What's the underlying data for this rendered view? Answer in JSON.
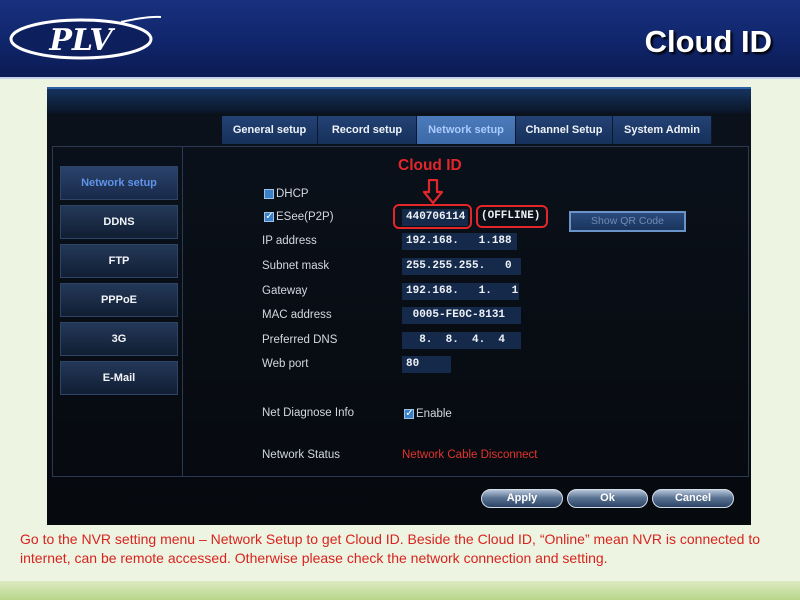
{
  "colors": {
    "banner": "#10256b",
    "slide_bg": "#edf4e1",
    "annotation_red": "#e3262a",
    "caption_red": "#d8231f",
    "status_red": "#e2352d",
    "tab_active": "#3c69a8"
  },
  "slide": {
    "logo_text": "PLV",
    "title": "Cloud ID",
    "caption": "Go to the NVR setting menu – Network Setup to get Cloud ID. Beside the Cloud ID, “Online” mean NVR is connected to internet, can be remote accessed. Otherwise please check the network connection and setting."
  },
  "annotation": {
    "label": "Cloud ID",
    "icon": "down-arrow-icon"
  },
  "nvr": {
    "tabs": [
      {
        "label": "General setup",
        "active": false
      },
      {
        "label": "Record setup",
        "active": false
      },
      {
        "label": "Network setup",
        "active": true
      },
      {
        "label": "Channel Setup",
        "active": false
      },
      {
        "label": "System Admin",
        "active": false
      }
    ],
    "sidebar": [
      {
        "label": "Network setup",
        "active": true
      },
      {
        "label": "DDNS",
        "active": false
      },
      {
        "label": "FTP",
        "active": false
      },
      {
        "label": "PPPoE",
        "active": false
      },
      {
        "label": "3G",
        "active": false
      },
      {
        "label": "E-Mail",
        "active": false
      }
    ],
    "form": {
      "dhcp": {
        "label": "DHCP",
        "checked": false
      },
      "esee": {
        "label": "ESee(P2P)",
        "checked": true,
        "cloud_id": "440706114",
        "status": "(OFFLINE)",
        "qr_button": "Show QR Code"
      },
      "ip_address": {
        "label": "IP address",
        "value": "192.168.   1.188"
      },
      "subnet_mask": {
        "label": "Subnet mask",
        "value": "255.255.255.   0"
      },
      "gateway": {
        "label": "Gateway",
        "value": "192.168.   1.   1"
      },
      "mac_address": {
        "label": "MAC address",
        "value": " 0005-FE0C-8131"
      },
      "preferred_dns": {
        "label": "Preferred DNS",
        "value": "  8.  8.  4.  4"
      },
      "web_port": {
        "label": "Web port",
        "value": "80"
      },
      "net_diagnose": {
        "label": "Net Diagnose Info",
        "option_label": "Enable",
        "checked": true
      },
      "network_status": {
        "label": "Network Status",
        "value": "Network Cable Disconnect"
      }
    },
    "buttons": {
      "apply": "Apply",
      "ok": "Ok",
      "cancel": "Cancel"
    }
  }
}
